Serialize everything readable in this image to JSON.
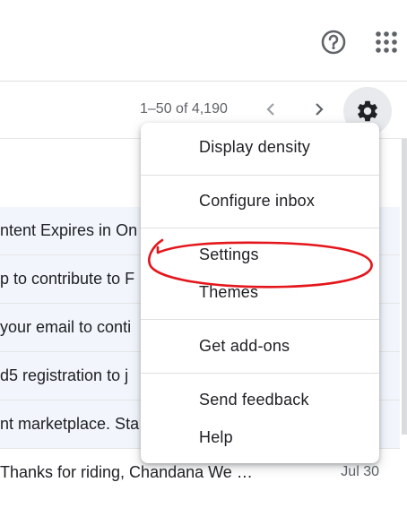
{
  "header": {
    "help_icon": "help-circle-icon",
    "apps_icon": "apps-grid-icon"
  },
  "toolbar": {
    "pagination": "1–50 of 4,190",
    "prev_icon": "chevron-left-icon",
    "next_icon": "chevron-right-icon",
    "settings_icon": "gear-icon"
  },
  "inbox": {
    "rows": [
      {
        "snippet": "ntent Expires in On"
      },
      {
        "snippet": "p to contribute to F"
      },
      {
        "snippet": "your email to conti"
      },
      {
        "snippet": "d5 registration to j"
      },
      {
        "snippet": "nt marketplace. Sta"
      },
      {
        "snippet": "Thanks for riding, Chandana We …",
        "date": "Jul 30"
      }
    ]
  },
  "settings_menu": {
    "items": [
      "Display density",
      "Configure inbox",
      "Settings",
      "Themes",
      "Get add-ons",
      "Send feedback",
      "Help"
    ]
  },
  "colors": {
    "annotation": "#e4161b",
    "unread_row_bg": "#f2f6fc",
    "gear_bg": "#e8eaed"
  }
}
